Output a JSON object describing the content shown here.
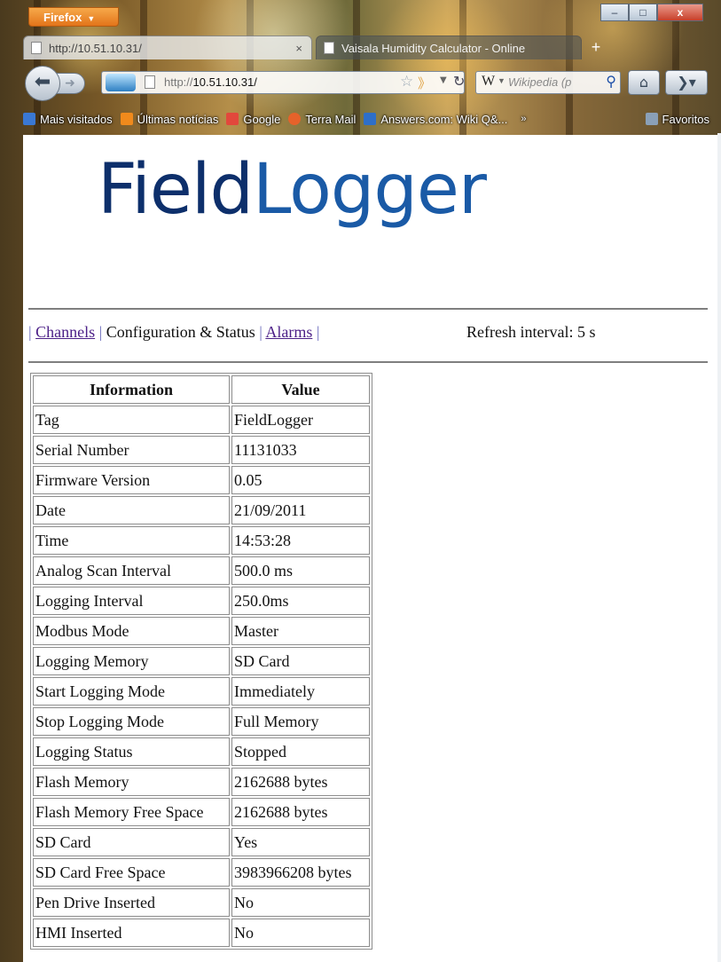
{
  "browser": {
    "menu_button": "Firefox",
    "window_controls": {
      "minimize": "–",
      "maximize": "□",
      "close": "x"
    },
    "tabs": [
      {
        "label": "http://10.51.10.31/",
        "close": "×",
        "active": true
      },
      {
        "label": "Vaisala Humidity Calculator - Online",
        "active": false
      }
    ],
    "new_tab": "+",
    "url_prefix": "http://",
    "url_host": "10.51.10.31/",
    "search_engine": "W",
    "search_placeholder": "Wikipedia (p",
    "bookmarks": [
      {
        "label": "Mais visitados",
        "icon": "most-visited-icon",
        "color": "#3a78d4"
      },
      {
        "label": "Últimas notícias",
        "icon": "rss-icon",
        "color": "#f08a1c"
      },
      {
        "label": "Google",
        "icon": "google-icon",
        "color": "#e2483c"
      },
      {
        "label": "Terra Mail",
        "icon": "terra-icon",
        "color": "#e6622a"
      },
      {
        "label": "Answers.com: Wiki Q&...",
        "icon": "answers-icon",
        "color": "#2e6fc8"
      }
    ],
    "bookmarks_overflow": "»",
    "favorites": "Favoritos"
  },
  "page": {
    "logo_part1": "Field",
    "logo_part2": "Logger",
    "nav": {
      "sep_left": "|",
      "channels": "Channels",
      "sep1": "|",
      "current": "Configuration & Status",
      "sep2": "|",
      "alarms": "Alarms",
      "sep_right": "|"
    },
    "refresh": "Refresh interval: 5 s",
    "table": {
      "headers": [
        "Information",
        "Value"
      ],
      "rows": [
        [
          "Tag",
          "FieldLogger"
        ],
        [
          "Serial Number",
          "11131033"
        ],
        [
          "Firmware Version",
          "0.05"
        ],
        [
          "Date",
          "21/09/2011"
        ],
        [
          "Time",
          "14:53:28"
        ],
        [
          "Analog Scan Interval",
          "500.0 ms"
        ],
        [
          "Logging Interval",
          "250.0ms"
        ],
        [
          "Modbus Mode",
          "Master"
        ],
        [
          "Logging Memory",
          "SD Card"
        ],
        [
          "Start Logging Mode",
          "Immediately"
        ],
        [
          "Stop Logging Mode",
          "Full Memory"
        ],
        [
          "Logging Status",
          "Stopped"
        ],
        [
          "Flash Memory",
          "2162688 bytes"
        ],
        [
          "Flash Memory Free Space",
          "2162688 bytes"
        ],
        [
          "SD Card",
          "Yes"
        ],
        [
          "SD Card Free Space",
          "3983966208 bytes"
        ],
        [
          "Pen Drive Inserted",
          "No"
        ],
        [
          "HMI Inserted",
          "No"
        ]
      ]
    }
  },
  "colors": {
    "link": "#4b1f87",
    "logo_dark": "#0d2f6b",
    "logo_light": "#1a5aa6"
  }
}
